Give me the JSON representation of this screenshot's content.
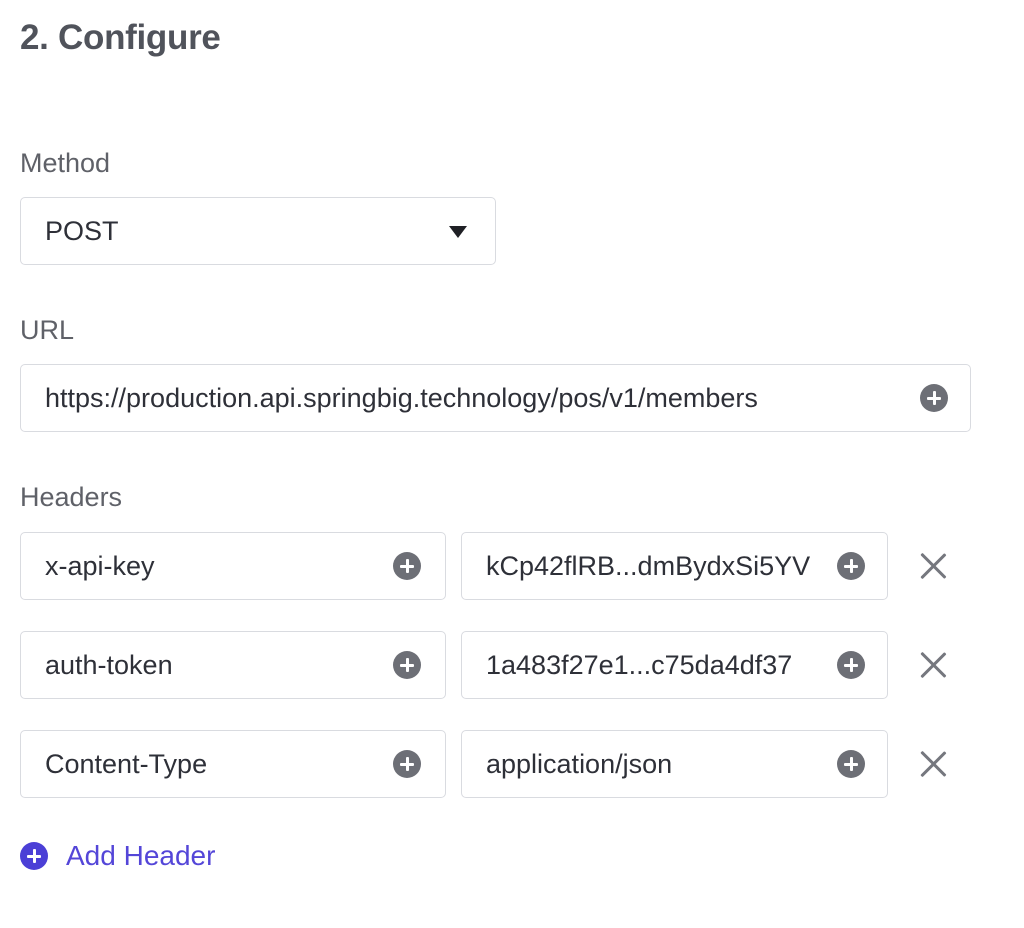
{
  "section": {
    "title": "2. Configure"
  },
  "method": {
    "label": "Method",
    "selected": "POST"
  },
  "url": {
    "label": "URL",
    "value": "https://production.api.springbig.technology/pos/v1/members"
  },
  "headers": {
    "label": "Headers",
    "rows": [
      {
        "key": "x-api-key",
        "value": "kCp42flRB...dmBydxSi5YV"
      },
      {
        "key": "auth-token",
        "value": "1a483f27e1...c75da4df37"
      },
      {
        "key": "Content-Type",
        "value": "application/json"
      }
    ],
    "add_label": "Add Header"
  },
  "icons": {
    "dropdown": "caret-down-icon",
    "insert_field": "plus-circle-icon",
    "remove": "close-icon",
    "add": "plus-circle-icon"
  },
  "colors": {
    "accent": "#5446d8",
    "border": "#d9dbe0",
    "icon": "#6d6f76"
  }
}
